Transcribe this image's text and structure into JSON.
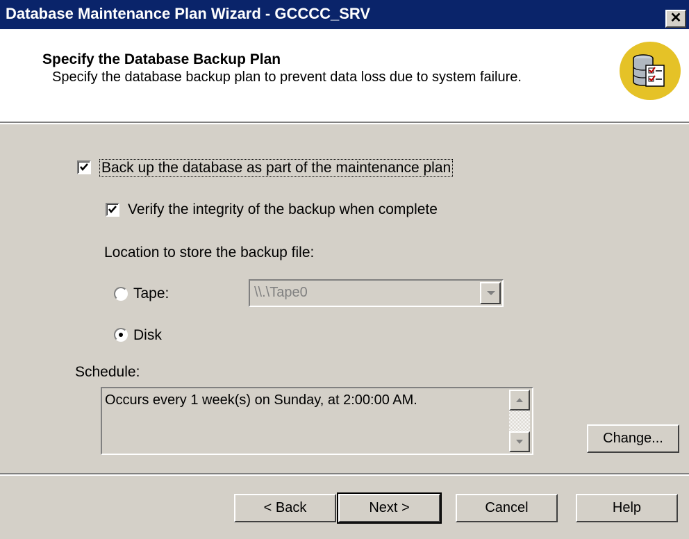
{
  "window": {
    "title": "Database Maintenance Plan Wizard - GCCCC_SRV",
    "close_glyph": "✕"
  },
  "header": {
    "title": "Specify the Database Backup Plan",
    "subtitle": "Specify the database backup plan to prevent data loss due to system failure.",
    "icon": "database-checklist-icon"
  },
  "backup": {
    "checkbox_label": "Back up the database as part of the maintenance plan",
    "checked": true,
    "verify_label": "Verify the integrity of the backup when complete",
    "verify_checked": true
  },
  "location": {
    "label": "Location to store the backup file:",
    "tape_label": "Tape:",
    "tape_value": "\\\\.\\Tape0",
    "disk_label": "Disk",
    "selected": "Disk"
  },
  "schedule": {
    "label": "Schedule:",
    "text": "Occurs every 1 week(s) on Sunday, at 2:00:00 AM.",
    "change_label": "Change..."
  },
  "buttons": {
    "back": "< Back",
    "next": "Next >",
    "cancel": "Cancel",
    "help": "Help"
  }
}
